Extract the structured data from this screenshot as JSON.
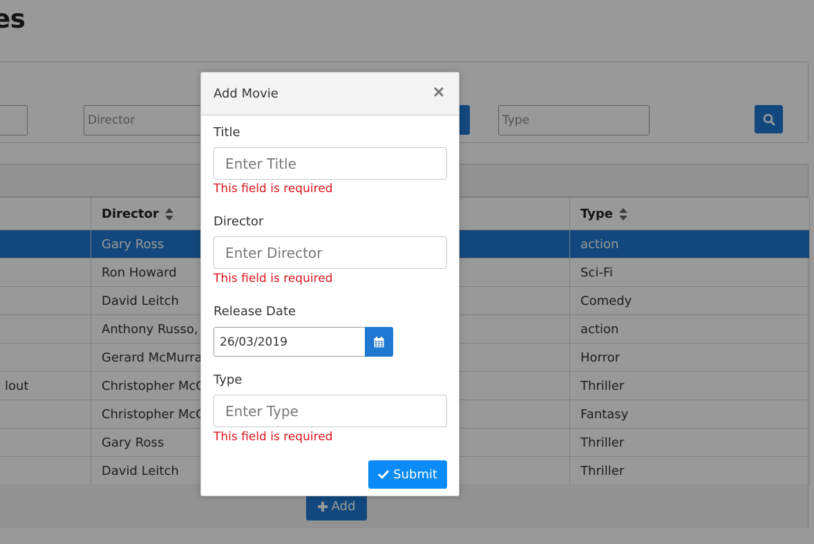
{
  "page": {
    "title": "ies"
  },
  "filters": {
    "director_placeholder": "Director",
    "type_placeholder": "Type"
  },
  "table": {
    "columns": [
      "",
      "Director",
      "",
      "Type"
    ],
    "rows": [
      {
        "title": "",
        "director": "Gary Ross",
        "type": "action",
        "selected": true
      },
      {
        "title": "",
        "director": "Ron Howard",
        "type": "Sci-Fi"
      },
      {
        "title": "",
        "director": "David Leitch",
        "type": "Comedy"
      },
      {
        "title": "",
        "director": "Anthony Russo, Jo",
        "type": "action"
      },
      {
        "title": "",
        "director": "Gerard McMurray",
        "type": "Horror"
      },
      {
        "title": "lout",
        "director": "Christopher McQu",
        "type": "Thriller"
      },
      {
        "title": "",
        "director": "Christopher McQu",
        "type": "Fantasy"
      },
      {
        "title": "",
        "director": "Gary Ross",
        "type": "Thriller"
      },
      {
        "title": "",
        "director": "David Leitch",
        "type": "Thriller"
      }
    ],
    "add_label": "Add"
  },
  "dialog": {
    "title": "Add Movie",
    "fields": {
      "title": {
        "label": "Title",
        "placeholder": "Enter Title",
        "error": "This field is required"
      },
      "director": {
        "label": "Director",
        "placeholder": "Enter Director",
        "error": "This field is required"
      },
      "release_date": {
        "label": "Release Date",
        "value": "26/03/2019"
      },
      "type": {
        "label": "Type",
        "placeholder": "Enter Type",
        "error": "This field is required"
      }
    },
    "submit_label": "Submit"
  },
  "colors": {
    "primary": "#1f78d1",
    "submit": "#0a8bf5",
    "error": "#d9131b"
  }
}
